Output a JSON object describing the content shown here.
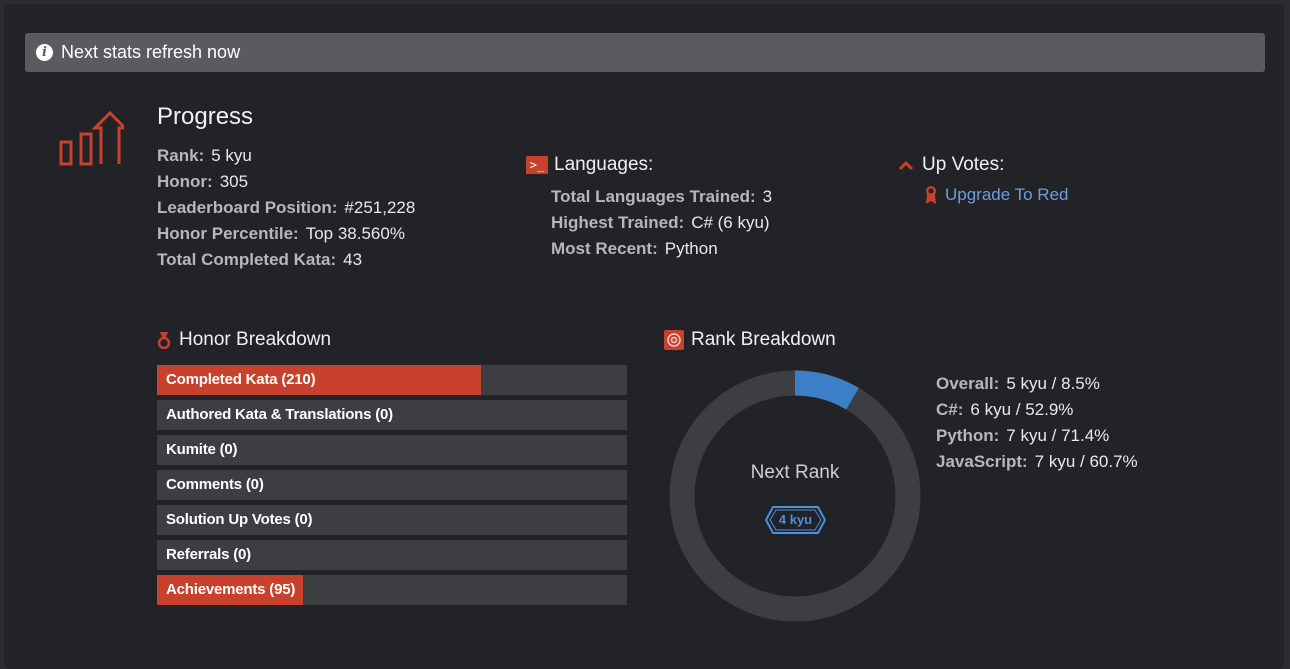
{
  "notice": {
    "icon": "info-icon",
    "text": "Next stats refresh now"
  },
  "progress": {
    "title": "Progress",
    "icon": "progress-chart-icon",
    "stats": [
      {
        "label": "Rank:",
        "value": "5 kyu"
      },
      {
        "label": "Honor:",
        "value": "305"
      },
      {
        "label": "Leaderboard Position:",
        "value": "#251,228"
      },
      {
        "label": "Honor Percentile:",
        "value": "Top 38.560%"
      },
      {
        "label": "Total Completed Kata:",
        "value": "43"
      }
    ]
  },
  "languages": {
    "title": "Languages:",
    "icon": "terminal-icon",
    "stats": [
      {
        "label": "Total Languages Trained:",
        "value": "3"
      },
      {
        "label": "Highest Trained:",
        "value": "C# (6 kyu)"
      },
      {
        "label": "Most Recent:",
        "value": "Python"
      }
    ]
  },
  "upvotes": {
    "title": "Up Votes:",
    "icon": "chevron-up-icon",
    "link_icon": "ribbon-icon",
    "link_text": "Upgrade To Red"
  },
  "honor_breakdown": {
    "title": "Honor Breakdown",
    "icon": "medal-icon",
    "bars": [
      {
        "label": "Completed Kata (210)",
        "fill": 0.69
      },
      {
        "label": "Authored Kata & Translations (0)",
        "fill": 0
      },
      {
        "label": "Kumite (0)",
        "fill": 0
      },
      {
        "label": "Comments (0)",
        "fill": 0
      },
      {
        "label": "Solution Up Votes (0)",
        "fill": 0
      },
      {
        "label": "Referrals (0)",
        "fill": 0
      },
      {
        "label": "Achievements (95)",
        "fill": 0.31
      }
    ]
  },
  "rank_breakdown": {
    "title": "Rank Breakdown",
    "icon": "target-icon",
    "progress_fraction": 0.085,
    "center_label": "Next Rank",
    "next_rank_badge": "4 kyu",
    "stats": [
      {
        "label": "Overall:",
        "value": "5 kyu / 8.5%"
      },
      {
        "label": "C#:",
        "value": "6 kyu / 52.9%"
      },
      {
        "label": "Python:",
        "value": "7 kyu / 71.4%"
      },
      {
        "label": "JavaScript:",
        "value": "7 kyu / 60.7%"
      }
    ]
  },
  "colors": {
    "accent": "#c8412d",
    "link": "#6d9ce3",
    "rank_blue": "#3c7fc7",
    "badge_blue": "#4a8fe0",
    "track": "#3d3e42"
  }
}
